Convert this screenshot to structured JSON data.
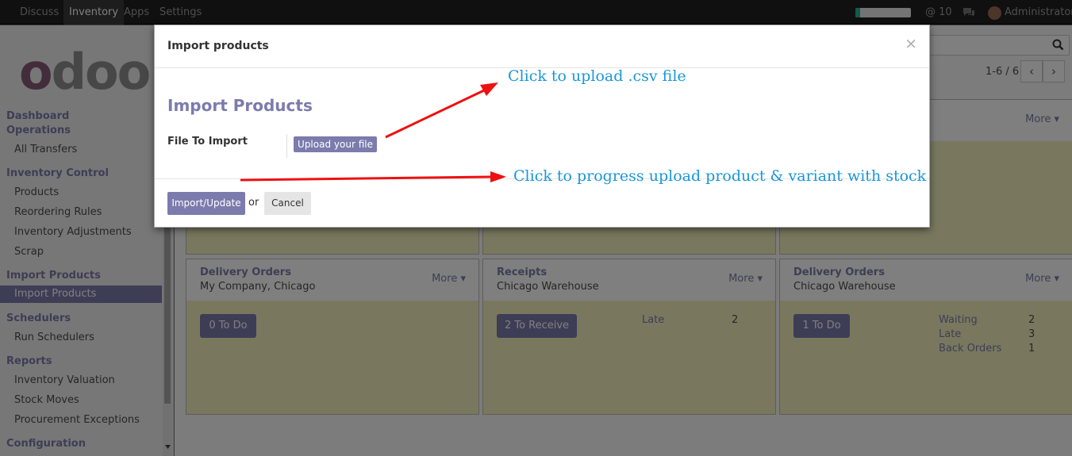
{
  "topbar": {
    "menu": [
      {
        "label": "Discuss",
        "active": false
      },
      {
        "label": "Inventory",
        "active": true
      },
      {
        "label": "Apps",
        "active": false
      },
      {
        "label": "Settings",
        "active": false
      }
    ],
    "progress_fraction": 0.08,
    "message_count": "@ 10",
    "user_name": "Administrator"
  },
  "sidebar": {
    "logo_text": "odoo",
    "sections": [
      {
        "label": "Dashboard",
        "items": []
      },
      {
        "label": "Operations",
        "items": [
          "All Transfers"
        ]
      },
      {
        "label": "Inventory Control",
        "items": [
          "Products",
          "Reordering Rules",
          "Inventory Adjustments",
          "Scrap"
        ]
      },
      {
        "label": "Import Products",
        "items": [
          "Import Products"
        ]
      },
      {
        "label": "Schedulers",
        "items": [
          "Run Schedulers"
        ]
      },
      {
        "label": "Reports",
        "items": [
          "Inventory Valuation",
          "Stock Moves",
          "Procurement Exceptions"
        ]
      },
      {
        "label": "Configuration",
        "items": []
      }
    ],
    "active_item": "Import Products"
  },
  "main": {
    "pager": "1-6 / 6",
    "cards_row1": [
      {
        "more": ""
      },
      {
        "more": ""
      },
      {
        "more": "More"
      }
    ],
    "cards_row2": [
      {
        "title": "Delivery Orders",
        "subtitle": "My Company, Chicago",
        "more": "More",
        "button": "0 To Do",
        "stats": []
      },
      {
        "title": "Receipts",
        "subtitle": "Chicago Warehouse",
        "more": "More",
        "button": "2 To Receive",
        "stats": [
          {
            "label": "Late",
            "value": "2"
          }
        ]
      },
      {
        "title": "Delivery Orders",
        "subtitle": "Chicago Warehouse",
        "more": "More",
        "button": "1 To Do",
        "stats": [
          {
            "label": "Waiting",
            "value": "2"
          },
          {
            "label": "Late",
            "value": "3"
          },
          {
            "label": "Back Orders",
            "value": "1"
          }
        ]
      }
    ]
  },
  "modal": {
    "title": "Import products",
    "close": "×",
    "form_title": "Import Products",
    "file_label": "File To Import",
    "upload_button": "Upload your file",
    "import_button": "Import/Update",
    "or_text": "or",
    "cancel_button": "Cancel"
  },
  "annotations": {
    "upload_note": "Click to upload .csv file",
    "import_note": "Click to progress upload product & variant with stock",
    "arrow_color": "#ee1111"
  }
}
